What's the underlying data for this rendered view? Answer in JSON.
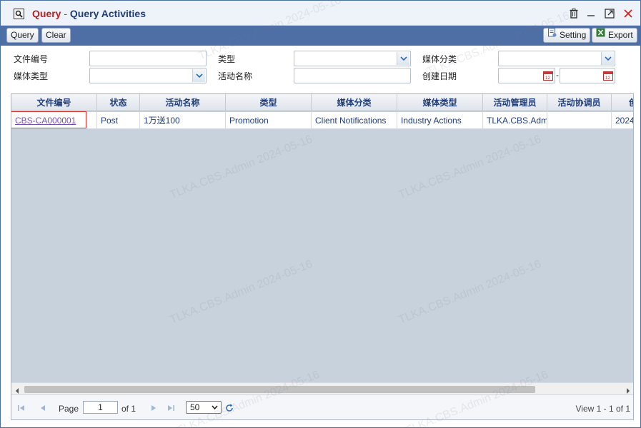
{
  "window": {
    "title_app": "Query",
    "title_separator": " - ",
    "title_page": "Query Activities"
  },
  "toolbar": {
    "query_label": "Query",
    "clear_label": "Clear",
    "setting_label": "Setting",
    "export_label": "Export"
  },
  "form": {
    "doc_no_label": "文件编号",
    "type_label": "类型",
    "media_category_label": "媒体分类",
    "media_type_label": "媒体类型",
    "activity_name_label": "活动名称",
    "created_date_label": "创建日期",
    "date_separator": "-",
    "doc_no_value": "",
    "type_value": "",
    "media_category_value": "",
    "media_type_value": "",
    "activity_name_value": "",
    "date_from_value": "",
    "date_to_value": ""
  },
  "grid": {
    "columns": [
      "文件编号",
      "状态",
      "活动名称",
      "类型",
      "媒体分类",
      "媒体类型",
      "活动管理员",
      "活动协调员",
      "创"
    ],
    "rows": [
      {
        "doc_no": "CBS-CA000001",
        "status": "Post",
        "name": "1万送100",
        "type": "Promotion",
        "media_category": "Client Notifications",
        "media_type": "Industry Actions",
        "manager": "TLKA.CBS.Admin",
        "coordinator": "",
        "created": "2024"
      }
    ]
  },
  "pager": {
    "page_label": "Page",
    "page_value": "1",
    "of_label": "of 1",
    "page_size": "50",
    "view_text": "View 1 - 1 of 1"
  },
  "watermark": "TLKA.CBS.Admin 2024-05-16",
  "colors": {
    "toolbar_bg": "#4e6ea6",
    "title_accent": "#b22222",
    "title_main": "#1f3d7a",
    "link": "#7a4db3",
    "highlight_border": "#e03030",
    "grid_empty_bg": "#c8d2dc"
  },
  "icons": {
    "title": "search-window-icon",
    "delete": "trash-icon",
    "minimize": "minimize-icon",
    "maximize": "maximize-icon",
    "close": "close-icon",
    "setting": "setting-icon",
    "export": "excel-icon",
    "calendar": "calendar-icon",
    "dropdown": "chevron-down-icon",
    "refresh": "refresh-icon"
  }
}
